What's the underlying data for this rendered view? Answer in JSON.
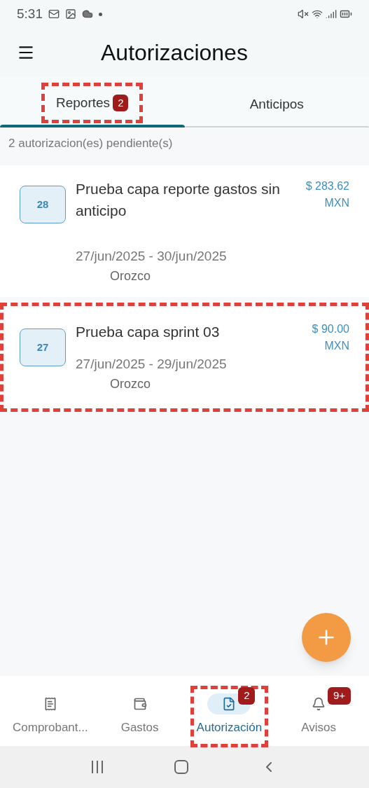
{
  "status_bar": {
    "time": "5:31"
  },
  "app_bar": {
    "title": "Autorizaciones"
  },
  "tabs": [
    {
      "label": "Reportes",
      "badge": "2",
      "selected": true,
      "highlighted": true
    },
    {
      "label": "Anticipos",
      "selected": false,
      "highlighted": false
    }
  ],
  "pending_summary": "2 autorizacion(es) pendiente(s)",
  "reports": [
    {
      "number": "28",
      "title": "Prueba capa reporte gastos sin anticipo",
      "amount": "$ 283.62",
      "currency": "MXN",
      "dates": "27/jun/2025 - 30/jun/2025",
      "person": "Orozco",
      "highlighted": false
    },
    {
      "number": "27",
      "title": "Prueba capa sprint 03",
      "amount": "$ 90.00",
      "currency": "MXN",
      "dates": "27/jun/2025 - 29/jun/2025",
      "person": "Orozco",
      "highlighted": true
    }
  ],
  "bottom_nav": [
    {
      "kind": "receipt",
      "label": "Comprobant...",
      "selected": false,
      "highlighted": false
    },
    {
      "kind": "wallet",
      "label": "Gastos",
      "selected": false,
      "highlighted": false
    },
    {
      "kind": "document",
      "label": "Autorización",
      "badge": "2",
      "selected": true,
      "highlighted": true
    },
    {
      "kind": "bell",
      "label": "Avisos",
      "badge": "9+",
      "selected": false,
      "highlighted": false
    }
  ]
}
